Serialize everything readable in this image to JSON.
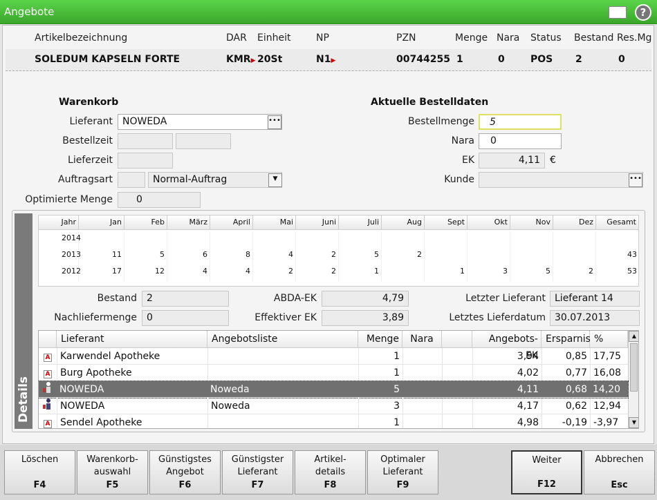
{
  "window": {
    "title": "Angebote"
  },
  "article": {
    "headers": {
      "name": "Artikelbezeichnung",
      "dar": "DAR",
      "unit": "Einheit",
      "np": "NP",
      "pzn": "PZN",
      "qty": "Menge",
      "nara": "Nara",
      "status": "Status",
      "stock": "Bestand",
      "resmg": "Res.Mg"
    },
    "name": "SOLEDUM KAPSELN FORTE",
    "dar": "KMR",
    "unit": "20St",
    "np": "N1",
    "pzn": "00744255",
    "qty": "1",
    "nara": "0",
    "status": "POS",
    "stock": "2",
    "resmg": "0"
  },
  "cart": {
    "title": "Warenkorb",
    "supplier_label": "Lieferant",
    "supplier": "NOWEDA",
    "ordertime_label": "Bestellzeit",
    "deliverytime_label": "Lieferzeit",
    "ordertype_label": "Auftragsart",
    "ordertype": "Normal-Auftrag",
    "optqty_label": "Optimierte Menge",
    "optqty": "0"
  },
  "order": {
    "title": "Aktuelle Bestelldaten",
    "qty_label": "Bestellmenge",
    "qty": "5",
    "nara_label": "Nara",
    "nara": "0",
    "ek_label": "EK",
    "ek": "4,11",
    "currency": "€",
    "customer_label": "Kunde"
  },
  "details": {
    "label": "Details"
  },
  "stats": {
    "headers": [
      "Jahr",
      "Jan",
      "Feb",
      "März",
      "April",
      "Mai",
      "Juni",
      "Juli",
      "Aug",
      "Sept",
      "Okt",
      "Nov",
      "Dez",
      "Gesamt"
    ],
    "rows": [
      [
        "2014",
        "",
        "",
        "",
        "",
        "",
        "",
        "",
        "",
        "",
        "",
        "",
        "",
        ""
      ],
      [
        "2013",
        "11",
        "5",
        "6",
        "8",
        "4",
        "2",
        "5",
        "2",
        "",
        "",
        "",
        "",
        "43"
      ],
      [
        "2012",
        "17",
        "12",
        "4",
        "4",
        "2",
        "2",
        "1",
        "",
        "1",
        "3",
        "5",
        "2",
        "53"
      ]
    ]
  },
  "info": {
    "stock_label": "Bestand",
    "stock": "2",
    "backorder_label": "Nachliefermenge",
    "backorder": "0",
    "abda_label": "ABDA-EK",
    "abda": "4,79",
    "eff_label": "Effektiver EK",
    "eff": "3,89",
    "lastsup_label": "Letzter Lieferant",
    "lastsup": "Lieferant 14",
    "lastdate_label": "Letztes Lieferdatum",
    "lastdate": "30.07.2013"
  },
  "offers": {
    "headers": {
      "supplier": "Lieferant",
      "list": "Angebotsliste",
      "qty": "Menge",
      "nara": "Nara",
      "price": "Angebots-EK",
      "saving": "Ersparnis",
      "pct": "%"
    },
    "rows": [
      {
        "supplier": "Karwendel Apotheke",
        "list": "",
        "qty": "1",
        "price": "3,94",
        "saving": "0,85",
        "pct": "17,75"
      },
      {
        "supplier": "Burg Apotheke",
        "list": "",
        "qty": "1",
        "price": "4,02",
        "saving": "0,77",
        "pct": "16,08"
      },
      {
        "supplier": "NOWEDA",
        "list": "Noweda",
        "qty": "5",
        "price": "4,11",
        "saving": "0,68",
        "pct": "14,20"
      },
      {
        "supplier": "NOWEDA",
        "list": "Noweda",
        "qty": "3",
        "price": "4,17",
        "saving": "0,62",
        "pct": "12,94"
      },
      {
        "supplier": "Sendel Apotheke",
        "list": "",
        "qty": "1",
        "price": "4,98",
        "saving": "-0,19",
        "pct": "-3,97"
      }
    ]
  },
  "fkeys": [
    {
      "l1": "Löschen",
      "l2": "",
      "key": "F4"
    },
    {
      "l1": "Warenkorb-",
      "l2": "auswahl",
      "key": "F5"
    },
    {
      "l1": "Günstigstes",
      "l2": "Angebot",
      "key": "F6"
    },
    {
      "l1": "Günstigster",
      "l2": "Lieferant",
      "key": "F7"
    },
    {
      "l1": "Artikel-",
      "l2": "details",
      "key": "F8"
    },
    {
      "l1": "Optimaler",
      "l2": "Lieferant",
      "key": "F9"
    },
    {
      "l1": "Weiter",
      "l2": "",
      "key": "F12"
    },
    {
      "l1": "Abbrechen",
      "l2": "",
      "key": "Esc"
    }
  ]
}
